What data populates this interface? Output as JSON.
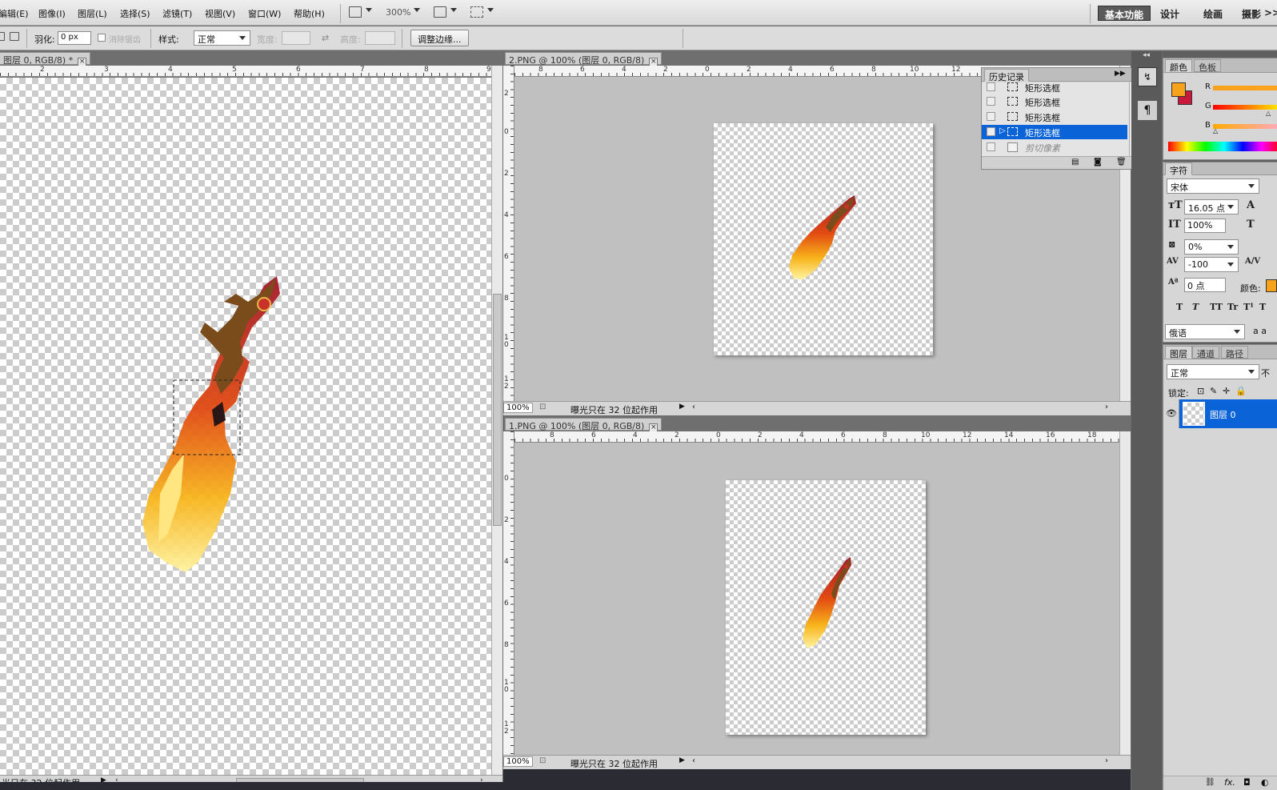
{
  "menubar": {
    "items": [
      "編辑(E)",
      "图像(I)",
      "图层(L)",
      "选择(S)",
      "滤镜(T)",
      "视图(V)",
      "窗口(W)",
      "帮助(H)"
    ],
    "zoom": "300%",
    "workspaces": [
      "基本功能",
      "设计",
      "绘画",
      "摄影"
    ],
    "more": ">>"
  },
  "options": {
    "feather_label": "羽化:",
    "feather_value": "0 px",
    "antialias_label": "消除锯齿",
    "style_label": "样式:",
    "style_value": "正常",
    "width_label": "宽度:",
    "height_label": "高度:",
    "refine_edge_button": "调整边缘..."
  },
  "doc_left": {
    "tab_title": "图层 0, RGB/8) *",
    "ruler_ticks": [
      "2",
      "3",
      "4",
      "5",
      "6",
      "7",
      "8",
      "9"
    ],
    "status_text": "光只在 32 位起作用"
  },
  "doc_top": {
    "tab_title": "2.PNG @ 100% (图层 0, RGB/8)",
    "ruler_ticks": [
      "8",
      "6",
      "4",
      "2",
      "0",
      "2",
      "4",
      "6",
      "8",
      "10",
      "12"
    ],
    "vruler_ticks": [
      "2",
      "0",
      "2",
      "4",
      "6",
      "8",
      "1\n0",
      "1\n2"
    ],
    "zoom": "100%",
    "status_text": "曝光只在 32 位起作用"
  },
  "doc_bottom": {
    "tab_title": "1.PNG @ 100% (图层 0, RGB/8)",
    "ruler_ticks": [
      "8",
      "6",
      "4",
      "2",
      "0",
      "2",
      "4",
      "6",
      "8",
      "10",
      "12",
      "14",
      "16",
      "18"
    ],
    "vruler_ticks": [
      "0",
      "2",
      "4",
      "6",
      "8",
      "1\n0",
      "1\n2"
    ],
    "zoom": "100%",
    "status_text": "曝光只在 32 位起作用"
  },
  "history": {
    "tab": "历史记录",
    "rows": [
      {
        "label": "矩形选框",
        "state": "normal"
      },
      {
        "label": "矩形选框",
        "state": "normal"
      },
      {
        "label": "矩形选框",
        "state": "normal"
      },
      {
        "label": "矩形选框",
        "state": "selected"
      },
      {
        "label": "剪切像素",
        "state": "dim"
      }
    ]
  },
  "color_panel": {
    "tabs": [
      "颜色",
      "色板"
    ],
    "channels": [
      "R",
      "G",
      "B"
    ],
    "fg_color": "#f6a21d",
    "bg_color": "#c8193c"
  },
  "character_panel": {
    "tab": "字符",
    "font": "宋体",
    "size": "16.05 点",
    "vscale": "100%",
    "tracking_pct": "0%",
    "kerning": "-100",
    "baseline": "0 点",
    "color_label": "颜色:",
    "language": "俄语",
    "aa_label": "a a",
    "style_buttons": [
      "T",
      "T",
      "TT",
      "Tr",
      "T¹",
      "T"
    ]
  },
  "layers_panel": {
    "tabs": [
      "图层",
      "通道",
      "路径"
    ],
    "blend_mode": "正常",
    "opacity_label": "不",
    "lock_label": "锁定:",
    "layer_name": "图层 0",
    "footer_icons": [
      "link-icon",
      "fx-icon",
      "mask-icon",
      "adjust-icon"
    ]
  },
  "colors": {
    "accent": "#0a64d8",
    "canvas_bg": "#c0c0c0",
    "panel_bg": "#d6d6d6"
  }
}
